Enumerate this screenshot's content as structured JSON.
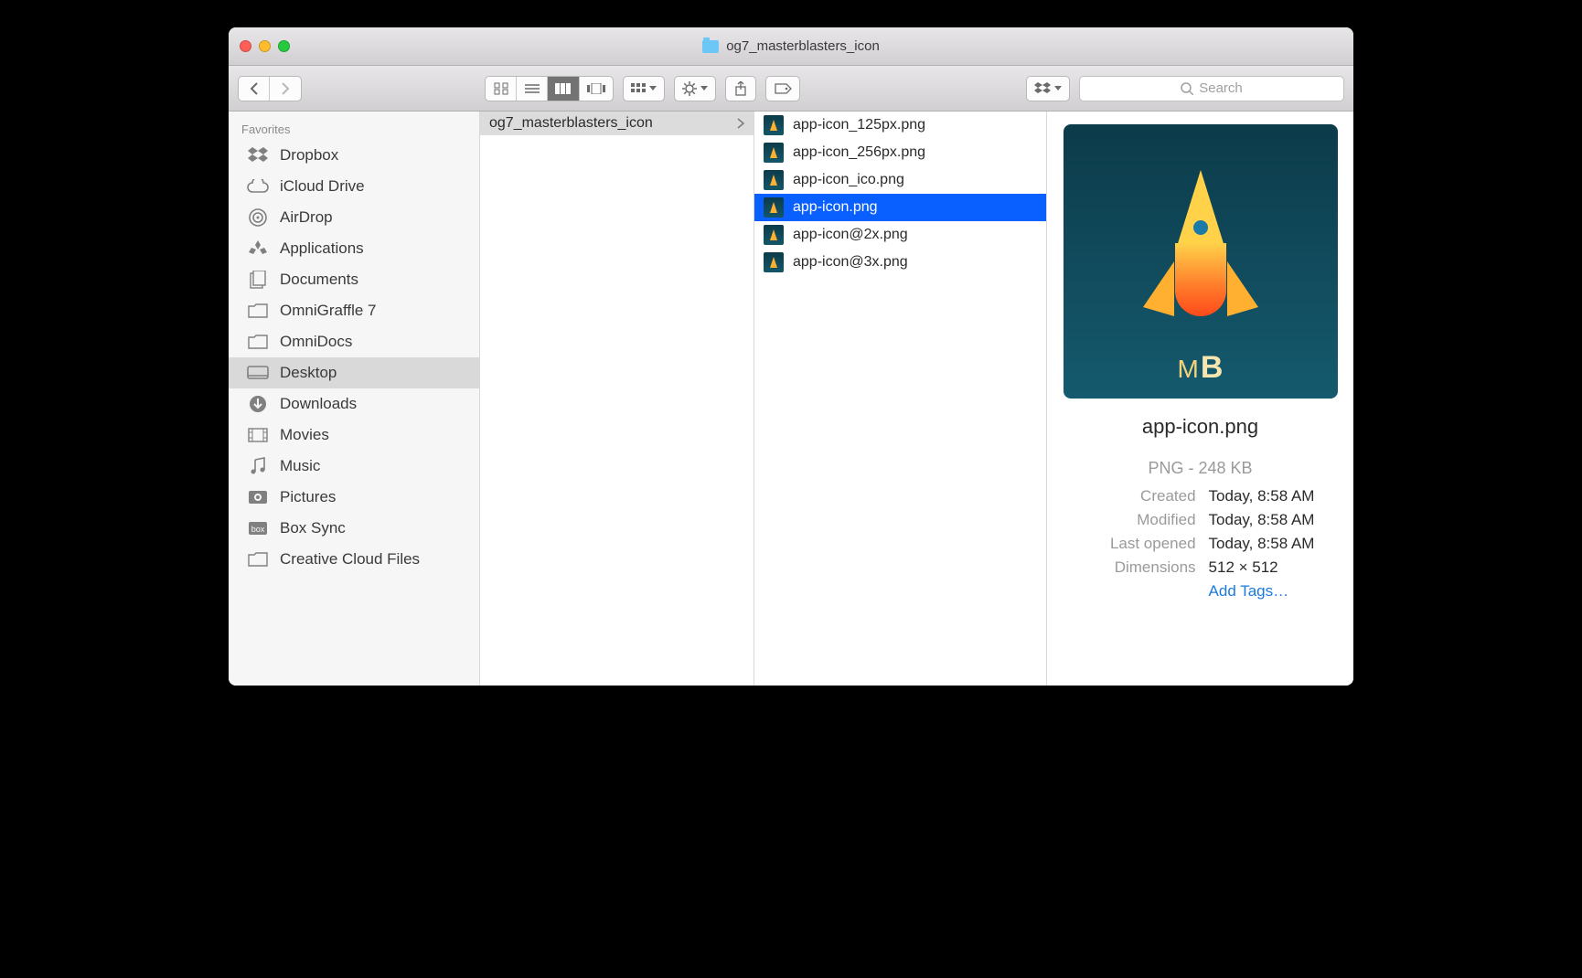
{
  "window": {
    "title": "og7_masterblasters_icon"
  },
  "toolbar": {
    "search_placeholder": "Search"
  },
  "sidebar": {
    "header": "Favorites",
    "items": [
      {
        "label": "Dropbox",
        "icon": "dropbox"
      },
      {
        "label": "iCloud Drive",
        "icon": "cloud"
      },
      {
        "label": "AirDrop",
        "icon": "airdrop"
      },
      {
        "label": "Applications",
        "icon": "app"
      },
      {
        "label": "Documents",
        "icon": "doc"
      },
      {
        "label": "OmniGraffle 7",
        "icon": "folder"
      },
      {
        "label": "OmniDocs",
        "icon": "folder"
      },
      {
        "label": "Desktop",
        "icon": "desktop",
        "selected": true
      },
      {
        "label": "Downloads",
        "icon": "download"
      },
      {
        "label": "Movies",
        "icon": "movie"
      },
      {
        "label": "Music",
        "icon": "music"
      },
      {
        "label": "Pictures",
        "icon": "picture"
      },
      {
        "label": "Box Sync",
        "icon": "box"
      },
      {
        "label": "Creative Cloud Files",
        "icon": "folder"
      }
    ]
  },
  "columns": {
    "col1": {
      "folder": "og7_masterblasters_icon"
    },
    "col2": {
      "files": [
        {
          "label": "app-icon_125px.png"
        },
        {
          "label": "app-icon_256px.png"
        },
        {
          "label": "app-icon_ico.png"
        },
        {
          "label": "app-icon.png",
          "selected": true
        },
        {
          "label": "app-icon@2x.png"
        },
        {
          "label": "app-icon@3x.png"
        }
      ]
    }
  },
  "preview": {
    "mb_m": "M",
    "mb_b": "B",
    "filename": "app-icon.png",
    "type_size": "PNG - 248 KB",
    "created_label": "Created",
    "created_value": "Today, 8:58 AM",
    "modified_label": "Modified",
    "modified_value": "Today, 8:58 AM",
    "opened_label": "Last opened",
    "opened_value": "Today, 8:58 AM",
    "dim_label": "Dimensions",
    "dim_value": "512 × 512",
    "tags_label": "Add Tags…"
  }
}
